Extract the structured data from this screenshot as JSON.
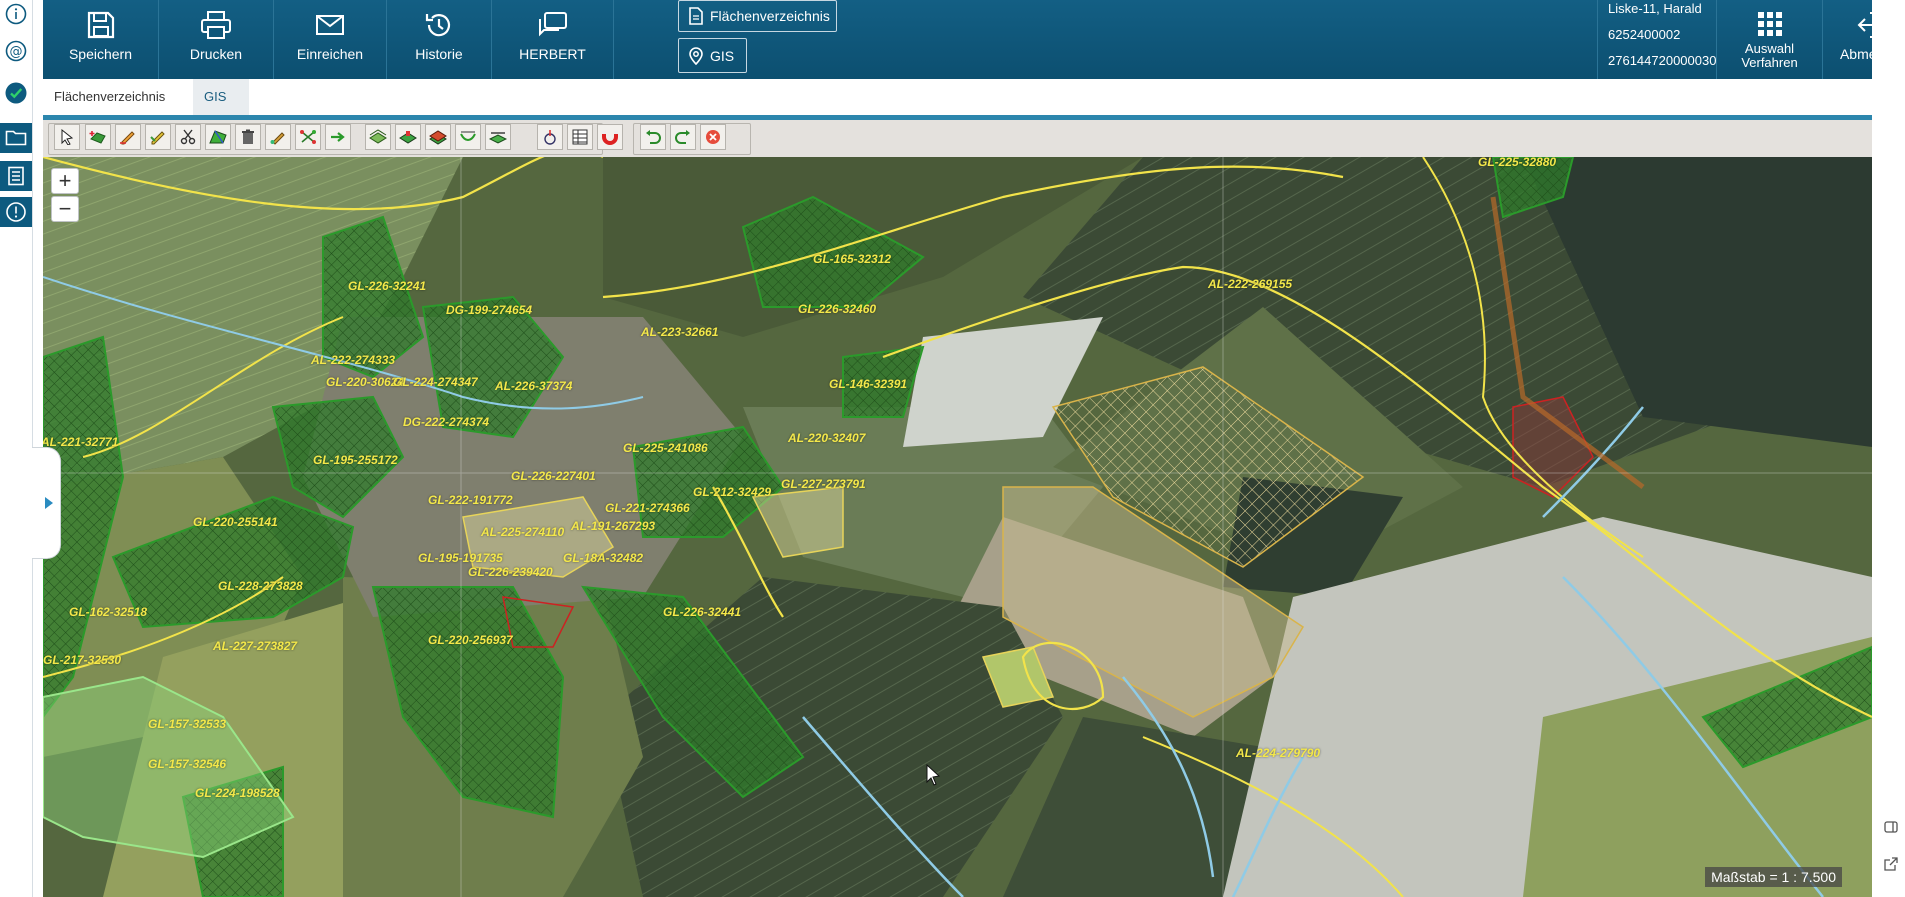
{
  "toolbar": {
    "save_label": "Speichern",
    "print_label": "Drucken",
    "submit_label": "Einreichen",
    "history_label": "Historie",
    "herbert_label": "HERBERT",
    "flaechen_label": "Flächenverzeichnis",
    "gis_label": "GIS",
    "auswahl_label_1": "Auswahl",
    "auswahl_label_2": "Verfahren",
    "logout_label": "Abmelden"
  },
  "user": {
    "name": "Liske-11, Harald",
    "id1": "6252400002",
    "id2": "276144720000030"
  },
  "tabs": [
    {
      "label": "Flächenverzeichnis"
    },
    {
      "label": "GIS"
    }
  ],
  "map": {
    "zoom_in": "+",
    "zoom_out": "−",
    "scale": "Maßstab = 1 : 7.500",
    "parcel_labels": [
      "GL-165-32312",
      "GL-226-32460",
      "AL-222-269155",
      "GL-226-32241",
      "DG-199-274654",
      "AL-223-32661",
      "AL-222-274333",
      "GL-220-30624",
      "GL-224-274347",
      "AL-226-37374",
      "GL-146-32391",
      "DG-222-274374",
      "AL-220-32407",
      "GL-225-241086",
      "AL-221-32771",
      "GL-195-255172",
      "GL-226-227401",
      "GL-222-191772",
      "GL-220-255141",
      "GL-221-274366",
      "AL-225-274110",
      "AL-191-267293",
      "GL-227-273791",
      "GL-212-32429",
      "GL-195-191735",
      "GL-226-239420",
      "GL-18A-32482",
      "GL-228-273828",
      "GL-226-32441",
      "GL-162-32518",
      "GL-220-256937",
      "AL-227-273827",
      "GL-217-32530",
      "GL-157-32533",
      "GL-157-32546",
      "GL-224-198528",
      "AL-224-279790",
      "GL-225-32880"
    ]
  },
  "colors": {
    "header_bg": "#0d5a7f",
    "tab_active_bg": "#e9edf0",
    "tab_underline": "#2c86ad",
    "map_toolbar_bg": "#e4e1dd",
    "parcel_label": "#f4e84a"
  }
}
